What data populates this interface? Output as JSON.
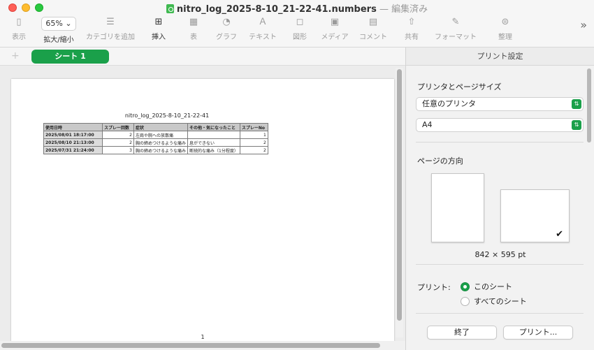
{
  "window": {
    "file_name": "nitro_log_2025-8-10_21-22-41.numbers",
    "separator": " — ",
    "status": "編集済み"
  },
  "toolbar": {
    "items": [
      {
        "label": "表示",
        "icon": "sidebar-icon"
      },
      {
        "label": "拡大/縮小",
        "icon": "zoom-icon",
        "value": "65%"
      },
      {
        "label": "カテゴリを追加",
        "icon": "list-icon"
      },
      {
        "label": "挿入",
        "icon": "plus-box-icon"
      },
      {
        "label": "表",
        "icon": "table-icon"
      },
      {
        "label": "グラフ",
        "icon": "chart-icon"
      },
      {
        "label": "テキスト",
        "icon": "text-icon"
      },
      {
        "label": "図形",
        "icon": "shape-icon"
      },
      {
        "label": "メディア",
        "icon": "media-icon"
      },
      {
        "label": "コメント",
        "icon": "comment-icon"
      },
      {
        "label": "共有",
        "icon": "share-icon"
      },
      {
        "label": "フォーマット",
        "icon": "brush-icon"
      },
      {
        "label": "整理",
        "icon": "organize-icon"
      }
    ]
  },
  "sheet_tab": {
    "label": "シート 1"
  },
  "sheet": {
    "title": "nitro_log_2025-8-10_21-22-41",
    "headers": [
      "使用日時",
      "スプレー回数",
      "症状",
      "その他・気になったこと",
      "スプレーNo"
    ],
    "rows": [
      [
        "2025/08/01 18:17:00",
        "2",
        "左肩や腕への放散痛",
        "",
        "1"
      ],
      [
        "2025/08/10 21:13:00",
        "2",
        "胸の締めつけるような痛み",
        "息ができない",
        "2"
      ],
      [
        "2025/07/31 21:24:00",
        "3",
        "胸の締めつけるような痛み",
        "断続的な痛み（1分程度）",
        "2"
      ]
    ],
    "page_number": "1"
  },
  "print_panel": {
    "title": "プリント設定",
    "printer_section": "プリンタとページサイズ",
    "printer_value": "任意のプリンタ",
    "paper_value": "A4",
    "orientation_section": "ページの方向",
    "page_size": "842 × 595 pt",
    "print_label": "プリント:",
    "option_this_sheet": "このシート",
    "option_all_sheets": "すべてのシート",
    "done_button": "終了",
    "print_button": "プリント..."
  },
  "colors": {
    "accent": "#1aa04a"
  }
}
